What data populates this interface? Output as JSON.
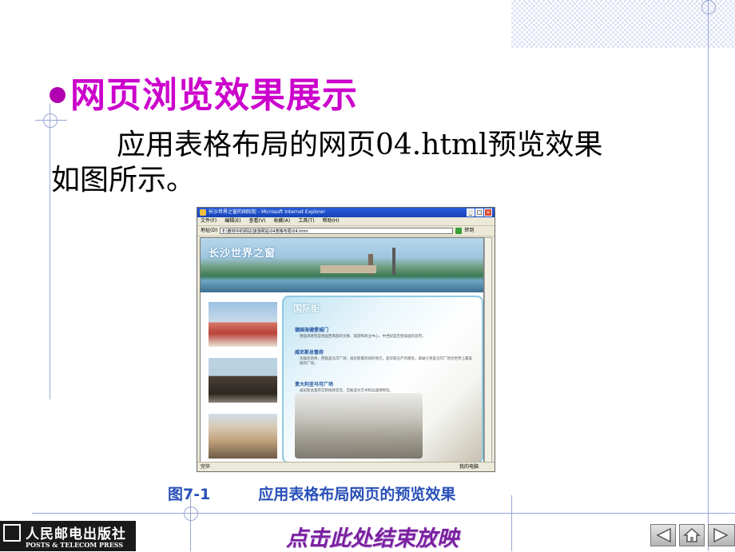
{
  "slide": {
    "title": "网页浏览效果展示",
    "body_line1": "应用表格布局的网页04.html预览效果",
    "body_line2": "如图所示。",
    "caption_fig": "图7-1",
    "caption_text": "应用表格布局网页的预览效果",
    "end_show_link": "点击此处结束放映",
    "publisher_cn": "人民邮电出版社",
    "publisher_en": "POSTS & TELECOM PRESS",
    "title_color": "#cc00cc",
    "caption_color": "#2850b8",
    "end_link_color": "#7a20a0"
  },
  "browser": {
    "window_title": "长沙世界之窗的国际街 - Microsoft Internet Explorer",
    "menu": [
      "文件(F)",
      "编辑(E)",
      "查看(V)",
      "收藏(A)",
      "工具(T)",
      "帮助(H)"
    ],
    "address_label": "地址(D)",
    "address_value": "E:\\教材中的网站\\旅游网站\\04表格布局\\04.html",
    "go_label": "转到",
    "status_left": "完毕",
    "status_right": "我的电脑"
  },
  "page": {
    "banner_logo": "长沙世界之窗",
    "panel_title": "国际街",
    "sections": [
      {
        "heading": "德国海德堡城门",
        "text": "德国海德堡是德国西南部的文教、旅游和商业中心，中世纪是巴登侯国的首府。"
      },
      {
        "heading": "威尼斯总督府",
        "text": "东临叹息桥，西临圣马可广场；威尼斯最热闹的地方，是华丽庄严的建筑，拿破仑称圣马可广场为世界上最美丽的广场。"
      },
      {
        "heading": "意大利圣马可广场",
        "text": "威尼斯总督府又称执政官宫，宫殿成为艺术和兵器博物馆。"
      }
    ]
  },
  "icons": [
    "prev-icon",
    "home-icon",
    "next-icon",
    "ie-icon"
  ]
}
